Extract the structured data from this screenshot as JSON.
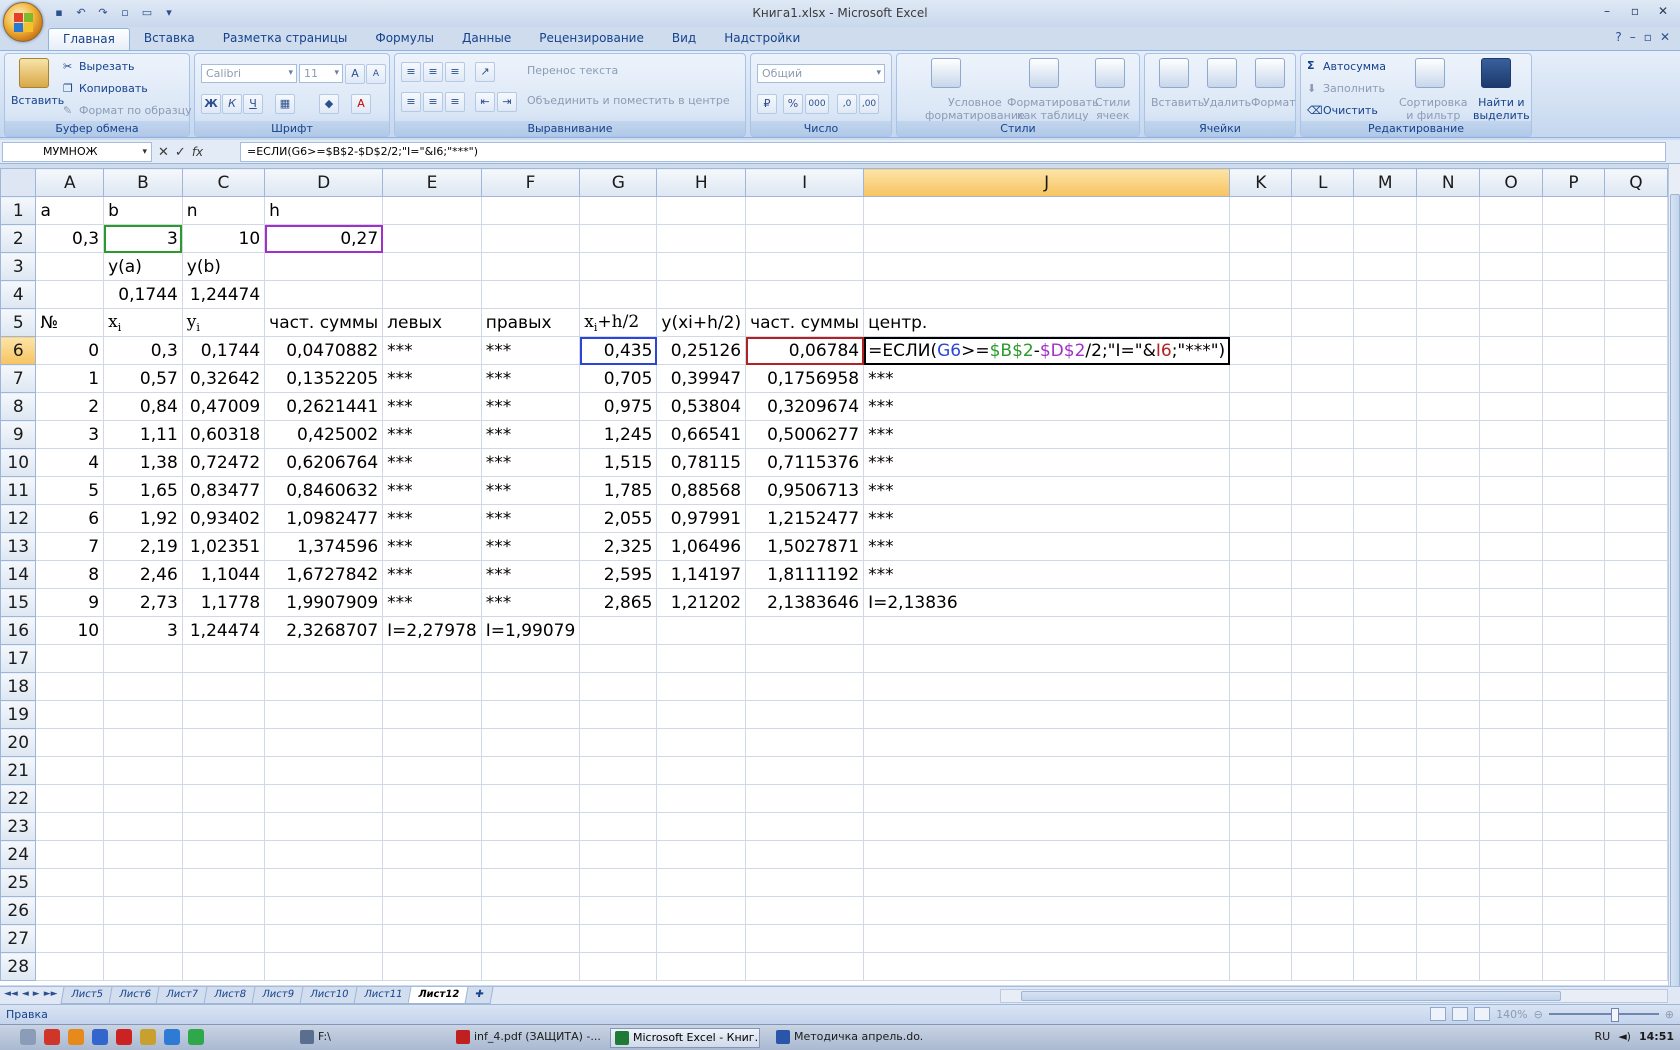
{
  "window": {
    "title": "Книга1.xlsx - Microsoft Excel"
  },
  "ribbon_tabs": [
    "Главная",
    "Вставка",
    "Разметка страницы",
    "Формулы",
    "Данные",
    "Рецензирование",
    "Вид",
    "Надстройки"
  ],
  "ribbon": {
    "clipboard": {
      "label": "Буфер обмена",
      "paste": "Вставить",
      "cut": "Вырезать",
      "copy": "Копировать",
      "format_painter": "Формат по образцу"
    },
    "font": {
      "label": "Шрифт",
      "font_name": "Calibri",
      "font_size": "11",
      "bold": "Ж",
      "italic": "К",
      "underline": "Ч"
    },
    "alignment": {
      "label": "Выравнивание",
      "wrap_text": "Перенос текста",
      "merge_center": "Объединить и поместить в центре"
    },
    "number": {
      "label": "Число",
      "format": "Общий",
      "percent": "%",
      "thousands": "000"
    },
    "styles": {
      "label": "Стили",
      "conditional_1": "Условное",
      "conditional_2": "форматирование",
      "as_table_1": "Форматировать",
      "as_table_2": "как таблицу",
      "cell_styles_1": "Стили",
      "cell_styles_2": "ячеек"
    },
    "cells": {
      "label": "Ячейки",
      "insert": "Вставить",
      "delete": "Удалить",
      "format": "Формат"
    },
    "editing": {
      "label": "Редактирование",
      "autosum": "Автосумма",
      "fill": "Заполнить",
      "clear": "Очистить",
      "sort_1": "Сортировка",
      "sort_2": "и фильтр",
      "find_1": "Найти и",
      "find_2": "выделить"
    }
  },
  "formula_bar": {
    "name_box": "МУМНОЖ",
    "formula": "=ЕСЛИ(G6>=$B$2-$D$2/2;\"I=\"&I6;\"***\")"
  },
  "columns": [
    "A",
    "B",
    "C",
    "D",
    "E",
    "F",
    "G",
    "H",
    "I",
    "J",
    "K",
    "L",
    "M",
    "N",
    "O",
    "P",
    "Q"
  ],
  "rows": [
    [
      "a",
      "b",
      "n",
      "h",
      "",
      "",
      "",
      "",
      "",
      ""
    ],
    [
      "0,3",
      "3",
      "10",
      "0,27",
      "",
      "",
      "",
      "",
      "",
      ""
    ],
    [
      "",
      "y(a)",
      "y(b)",
      "",
      "",
      "",
      "",
      "",
      "",
      ""
    ],
    [
      "",
      "0,1744",
      "1,24474",
      "",
      "",
      "",
      "",
      "",
      "",
      ""
    ],
    [
      "№",
      "x",
      "y",
      "част. суммы",
      "левых",
      "правых",
      "x",
      "y(xi+h/2)",
      "част. суммы",
      "центр."
    ],
    [
      "0",
      "0,3",
      "0,1744",
      "0,0470882",
      "***",
      "***",
      "0,435",
      "0,25126",
      "0,06784",
      ""
    ],
    [
      "1",
      "0,57",
      "0,32642",
      "0,1352205",
      "***",
      "***",
      "0,705",
      "0,39947",
      "0,1756958",
      "***"
    ],
    [
      "2",
      "0,84",
      "0,47009",
      "0,2621441",
      "***",
      "***",
      "0,975",
      "0,53804",
      "0,3209674",
      "***"
    ],
    [
      "3",
      "1,11",
      "0,60318",
      "0,425002",
      "***",
      "***",
      "1,245",
      "0,66541",
      "0,5006277",
      "***"
    ],
    [
      "4",
      "1,38",
      "0,72472",
      "0,6206764",
      "***",
      "***",
      "1,515",
      "0,78115",
      "0,7115376",
      "***"
    ],
    [
      "5",
      "1,65",
      "0,83477",
      "0,8460632",
      "***",
      "***",
      "1,785",
      "0,88568",
      "0,9506713",
      "***"
    ],
    [
      "6",
      "1,92",
      "0,93402",
      "1,0982477",
      "***",
      "***",
      "2,055",
      "0,97991",
      "1,2152477",
      "***"
    ],
    [
      "7",
      "2,19",
      "1,02351",
      "1,374596",
      "***",
      "***",
      "2,325",
      "1,06496",
      "1,5027871",
      "***"
    ],
    [
      "8",
      "2,46",
      "1,1044",
      "1,6727842",
      "***",
      "***",
      "2,595",
      "1,14197",
      "1,8111192",
      "***"
    ],
    [
      "9",
      "2,73",
      "1,1778",
      "1,9907909",
      "***",
      "***",
      "2,865",
      "1,21202",
      "2,1383646",
      "I=2,13836"
    ],
    [
      "10",
      "3",
      "1,24474",
      "2,3268707",
      "I=2,27978",
      "I=1,99079",
      "",
      "",
      "",
      ""
    ]
  ],
  "row_count": 28,
  "subscripts": {
    "B5": "i",
    "C5": "i",
    "G5_sub": "i",
    "G5_suffix": "+h/2"
  },
  "edit_cell": {
    "prefix": "=ЕСЛИ(",
    "ref1": "G6",
    "op": ">=",
    "ref2": "$B$2",
    "minus": "-",
    "ref3": "$D$2",
    "rest1": "/2;\"I=\"&",
    "ref4": "I6",
    "rest2": ";\"***\")"
  },
  "sheet_tabs": [
    "Лист5",
    "Лист6",
    "Лист7",
    "Лист8",
    "Лист9",
    "Лист10",
    "Лист11",
    "Лист12"
  ],
  "active_sheet": "Лист12",
  "status": {
    "mode": "Правка",
    "zoom": "140%"
  },
  "taskbar": {
    "items": [
      "F:\\",
      "inf_4.pdf (ЗАЩИТА) -...",
      "Microsoft Excel - Книг...",
      "Методичка апрель.do..."
    ],
    "lang": "RU",
    "clock": "14:51"
  },
  "colors": {
    "ref_blue": "#2b46d6",
    "ref_green": "#2a9a2a",
    "ref_purple": "#a22fc9",
    "ref_red": "#b22222"
  }
}
